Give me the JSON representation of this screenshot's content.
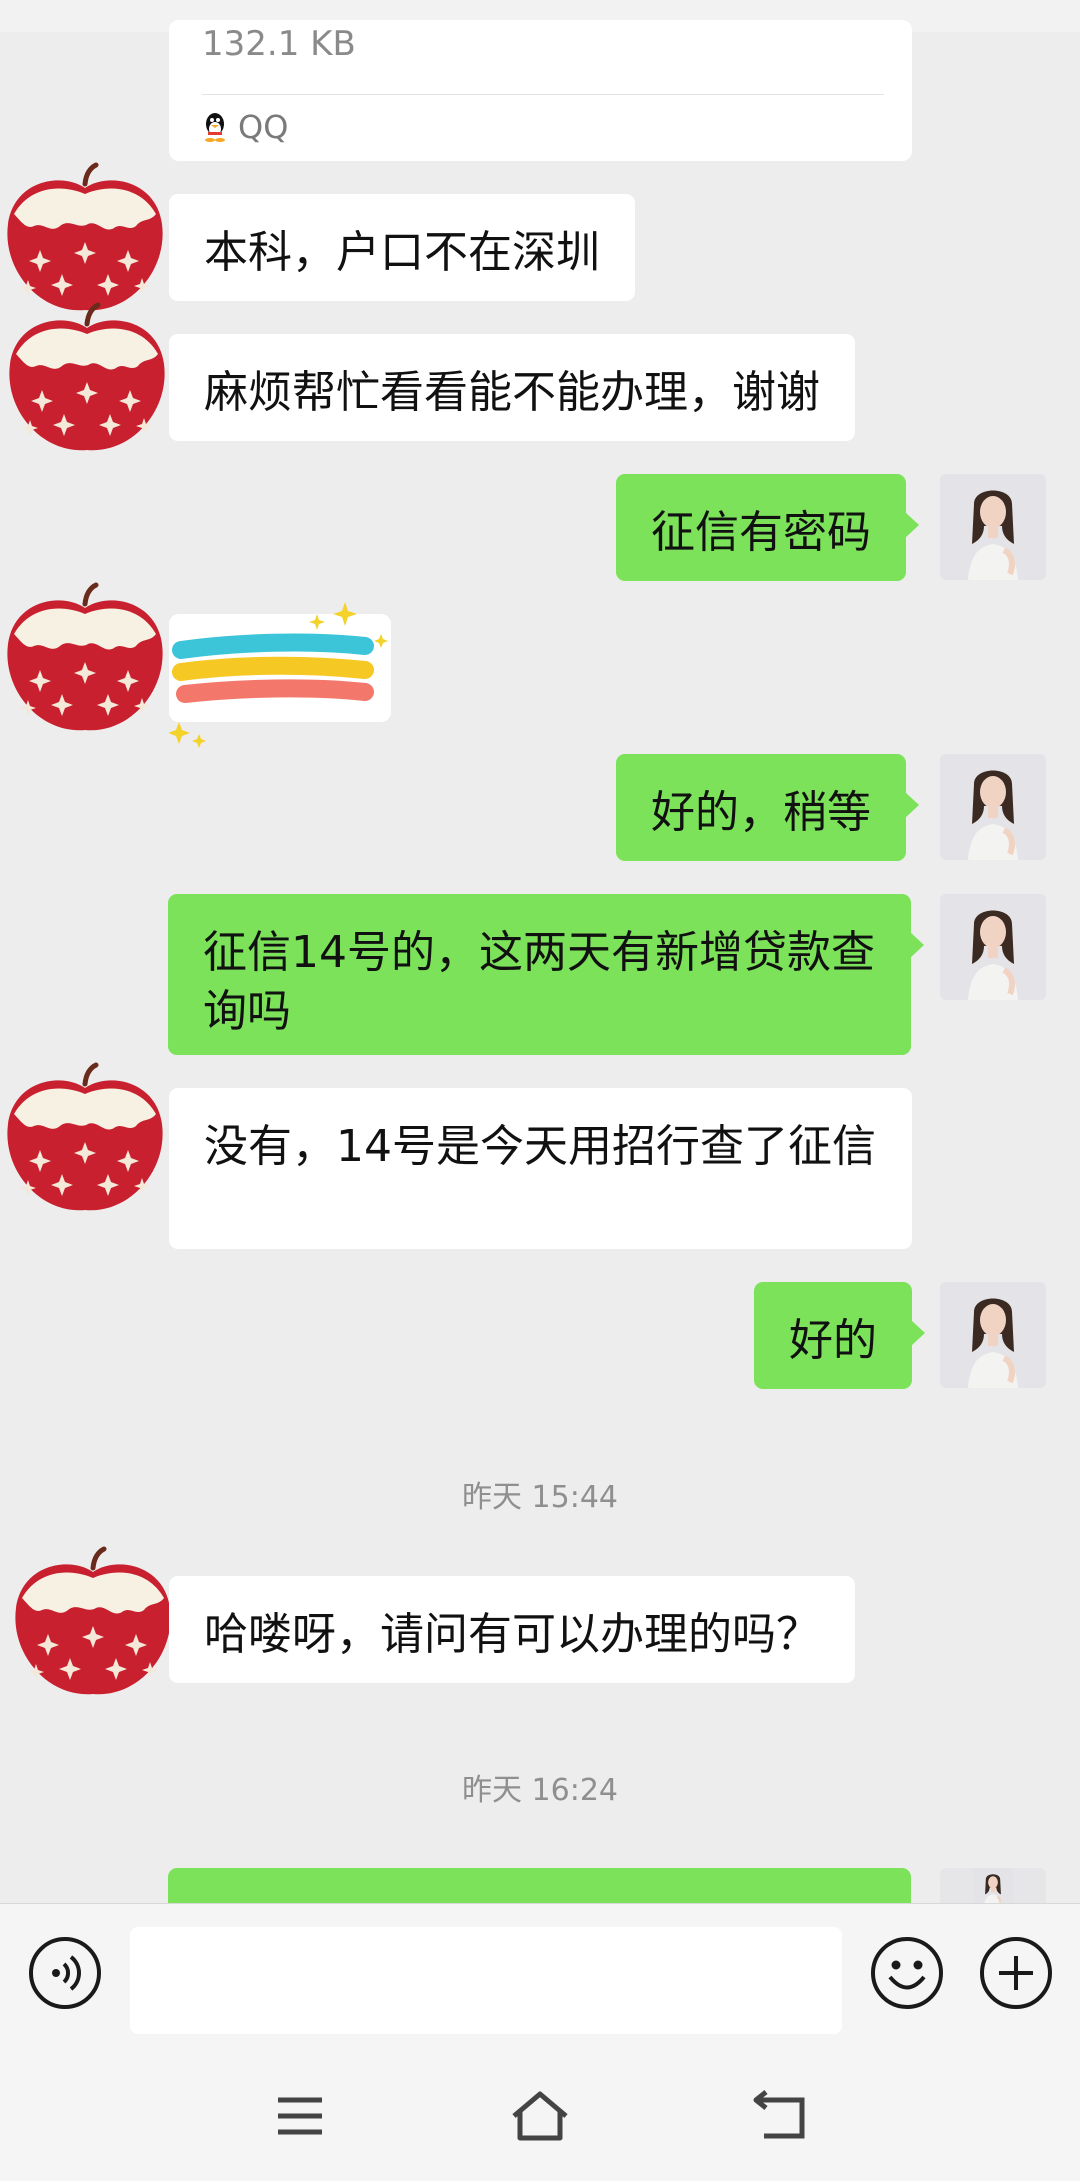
{
  "file_card": {
    "size": "132.1 KB",
    "source": "QQ"
  },
  "messages": [
    {
      "side": "in",
      "text": "本科，户口不在深圳"
    },
    {
      "side": "in",
      "text": "麻烦帮忙看看能不能办理，谢谢"
    },
    {
      "side": "out",
      "text": "征信有密码"
    },
    {
      "side": "in",
      "type": "sticker",
      "icon": "rainbow-sticker"
    },
    {
      "side": "out",
      "text": "好的，稍等"
    },
    {
      "side": "out",
      "text": "征信14号的，这两天有新增贷款查询吗"
    },
    {
      "side": "in",
      "text": "没有，14号是今天用招行查了征信"
    },
    {
      "side": "out",
      "text": "好的"
    },
    {
      "side": "in",
      "text": "哈喽呀，请问有可以办理的吗？"
    }
  ],
  "timestamps": [
    "昨天 15:44",
    "昨天 16:24"
  ],
  "colors": {
    "chat_bg": "#ededed",
    "out_bubble": "#7be25a",
    "in_bubble": "#ffffff"
  },
  "input_bar": {
    "icons": [
      "voice-icon",
      "emoji-icon",
      "add-icon"
    ]
  },
  "nav_bar": {
    "icons": [
      "menu-icon",
      "home-icon",
      "back-icon"
    ]
  }
}
